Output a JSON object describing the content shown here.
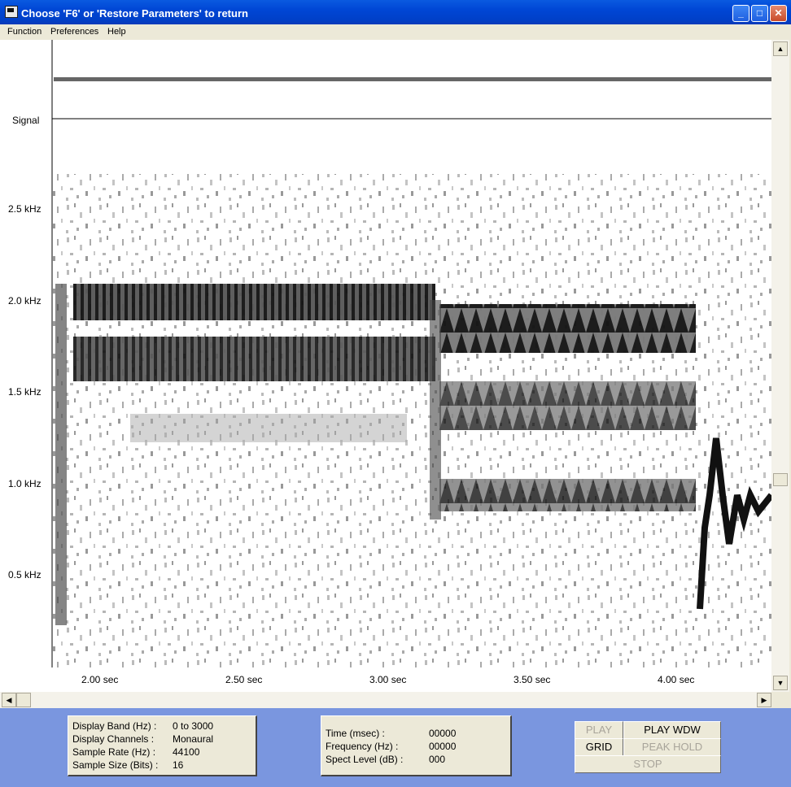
{
  "window": {
    "title": "Choose 'F6' or 'Restore Parameters' to return"
  },
  "menu": [
    "Function",
    "Preferences",
    "Help"
  ],
  "plot": {
    "signal_label": "Signal",
    "y_ticks": [
      "2.5 kHz",
      "2.0 kHz",
      "1.5 kHz",
      "1.0 kHz",
      "0.5 kHz"
    ],
    "x_ticks": [
      "2.00 sec",
      "2.50 sec",
      "3.00 sec",
      "3.50 sec",
      "4.00 sec"
    ]
  },
  "params": {
    "labels": [
      "Display Band (Hz) :",
      "Display Channels :",
      "Sample Rate (Hz) :",
      "Sample Size (Bits) :"
    ],
    "values": [
      "0 to 3000",
      "Monaural",
      "44100",
      "16"
    ]
  },
  "readout": {
    "labels": [
      "Time (msec) :",
      "Frequency (Hz) :",
      "Spect Level (dB) :"
    ],
    "values": [
      "00000",
      "00000",
      "000"
    ]
  },
  "buttons": {
    "play": "PLAY",
    "play_wdw": "PLAY WDW",
    "grid": "GRID",
    "peak_hold": "PEAK HOLD",
    "stop": "STOP"
  },
  "icons": {
    "app": "app-icon",
    "minimize": "minimize-icon",
    "maximize": "maximize-icon",
    "close": "close-icon"
  }
}
